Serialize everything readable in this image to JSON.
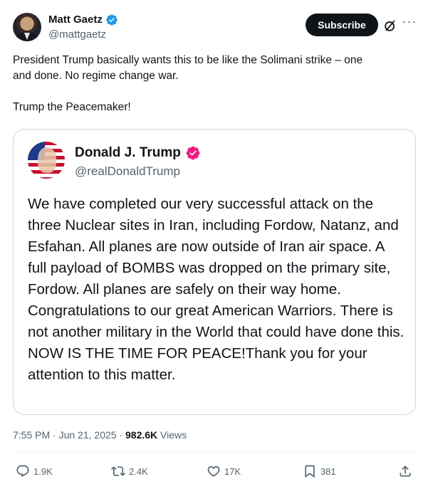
{
  "author": {
    "name": "Matt Gaetz",
    "handle": "@mattgaetz",
    "verified_color": "#1d9bf0"
  },
  "header": {
    "subscribe_label": "Subscribe",
    "grok_icon": "grok-icon",
    "more_icon": "more-icon",
    "more_glyph": "···"
  },
  "tweet": {
    "text_line1": "President Trump basically wants this to be like the Solimani strike – one\nand done. No regime change war.",
    "text_line2": "Trump the Peacemaker!"
  },
  "quoted": {
    "name": "Donald J. Trump",
    "handle": "@realDonaldTrump",
    "verified_color": "#f91880",
    "text": "We have completed our very successful attack on the three Nuclear sites in Iran, including Fordow, Natanz, and Esfahan. All planes are now outside of Iran air space. A full payload of BOMBS was dropped on the primary site, Fordow. All planes are safely on their way home. Congratulations to our great American Warriors. There is not another military in the World that could have done this. NOW IS THE TIME FOR PEACE!Thank you for your attention to this matter."
  },
  "meta": {
    "time": "7:55 PM",
    "separator1": " · ",
    "date": "Jun 21, 2025",
    "separator2": " · ",
    "views_count": "982.6K",
    "views_label": " Views"
  },
  "actions": {
    "replies": "1.9K",
    "reposts": "2.4K",
    "likes": "17K",
    "bookmarks": "381"
  },
  "colors": {
    "text_primary": "#0f1419",
    "text_secondary": "#536471",
    "border": "#cfd9de"
  }
}
